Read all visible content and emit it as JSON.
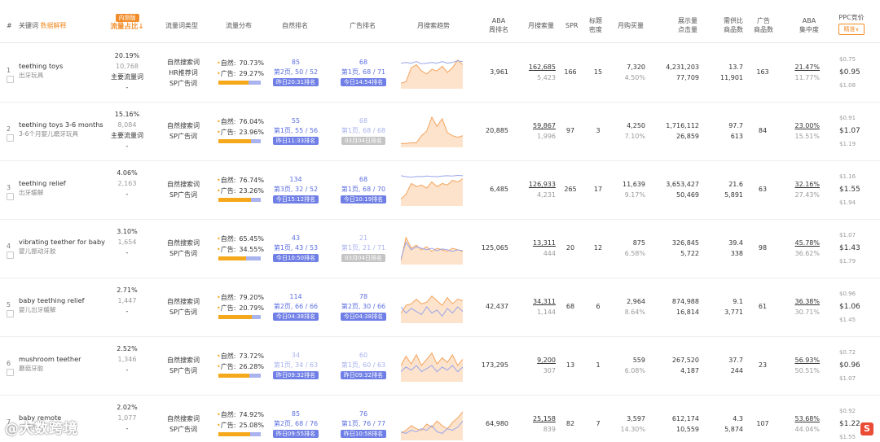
{
  "header": {
    "hash": "#",
    "keyword": "关键词",
    "keyword_link": "数据解释",
    "traffic_badge": "内测版",
    "traffic_share": "流量占比↓",
    "traffic_type": "流量词类型",
    "traffic_dist": "流量分布",
    "natural_rank": "自然排名",
    "ad_rank": "广告排名",
    "monthly_trend": "月搜索趋势",
    "aba_week_1": "ABA",
    "aba_week_2": "周排名",
    "monthly_search": "月搜索量",
    "spr": "SPR",
    "title_density_1": "标题",
    "title_density_2": "密度",
    "monthly_buy": "月购买量",
    "impressions_1": "展示量",
    "impressions_2": "点击量",
    "supply_1": "需供比",
    "supply_2": "商品数",
    "ad_products_1": "广告",
    "ad_products_2": "商品数",
    "aba_conc_1": "ABA",
    "aba_conc_2": "集中度",
    "ppc": "PPC竞价",
    "ppc_mode": "精准∨"
  },
  "rows": [
    {
      "idx": "1",
      "kw": "teething toys",
      "kwcn": "出牙玩具",
      "share": "20.19%",
      "share_count": "10,768",
      "main": "主要流量词",
      "dash": "-",
      "types": [
        "自然搜索词",
        "HR推荐词",
        "SP广告词"
      ],
      "nat_lbl": "自然:",
      "nat": "70.73%",
      "ad_lbl": "广告:",
      "ad": "29.27%",
      "nat_frac": 0.7073,
      "nrank": "85",
      "npage": "第2页, 50 / 52",
      "npill": "昨日20:31排名",
      "npill_gray": false,
      "nrank_gray": false,
      "arank": "68",
      "apage": "第1页, 68 / 71",
      "apill": "今日14:54排名",
      "apill_gray": false,
      "arank_gray": false,
      "aba": "3,961",
      "ms": "162,685",
      "ms2": "5,423",
      "spr": "166",
      "td": "15",
      "mb": "7,320",
      "mb2": "4.50%",
      "imp": "4,231,203",
      "clk": "77,709",
      "sup": "13.7",
      "prod": "11,901",
      "adp": "163",
      "conc": "21.47%",
      "conc2": "11.77%",
      "ppc_hi": "$0.75",
      "ppc": "$0.95",
      "ppc_lo": "$1.08",
      "trend": [
        0.15,
        0.2,
        0.65,
        0.75,
        0.55,
        0.45,
        0.6,
        0.55,
        0.7,
        0.5,
        0.65,
        0.9,
        0.75
      ],
      "trend2": [
        0.8,
        0.82,
        0.8,
        0.85,
        0.78,
        0.8,
        0.82,
        0.8,
        0.85,
        0.8,
        0.82,
        0.88,
        0.85
      ]
    },
    {
      "idx": "2",
      "kw": "teething toys 3-6 months",
      "kwcn": "3-6个月婴儿磨牙玩具",
      "share": "15.16%",
      "share_count": "8,084",
      "main": "主要流量词",
      "dash": "-",
      "types": [
        "自然搜索词",
        "SP广告词"
      ],
      "nat_lbl": "自然:",
      "nat": "76.04%",
      "ad_lbl": "广告:",
      "ad": "23.96%",
      "nat_frac": 0.7604,
      "nrank": "55",
      "npage": "第1页, 55 / 56",
      "npill": "昨日11:33排名",
      "npill_gray": false,
      "nrank_gray": false,
      "arank": "68",
      "apage": "第1页, 68 / 68",
      "apill": "03月04日排名",
      "apill_gray": true,
      "arank_gray": true,
      "aba": "20,885",
      "ms": "59,867",
      "ms2": "1,996",
      "spr": "97",
      "td": "3",
      "mb": "4,250",
      "mb2": "7.10%",
      "imp": "1,716,112",
      "clk": "26,859",
      "sup": "97.7",
      "prod": "613",
      "adp": "84",
      "conc": "23.00%",
      "conc2": "15.51%",
      "ppc_hi": "$0.91",
      "ppc": "$1.07",
      "ppc_lo": "$1.19",
      "trend": [
        0.1,
        0.1,
        0.12,
        0.12,
        0.35,
        0.5,
        0.95,
        0.65,
        0.9,
        0.45,
        0.35,
        0.3,
        0.35
      ],
      "trend2": null
    },
    {
      "idx": "3",
      "kw": "teething relief",
      "kwcn": "出牙缓解",
      "share": "4.06%",
      "share_count": "2,163",
      "main": "",
      "dash": "-",
      "types": [
        "自然搜索词",
        "SP广告词"
      ],
      "nat_lbl": "自然:",
      "nat": "76.74%",
      "ad_lbl": "广告:",
      "ad": "23.26%",
      "nat_frac": 0.7674,
      "nrank": "134",
      "npage": "第3页, 32 / 52",
      "npill": "今日15:12排名",
      "npill_gray": false,
      "nrank_gray": false,
      "arank": "68",
      "apage": "第1页, 68 / 70",
      "apill": "今日10:19排名",
      "apill_gray": false,
      "arank_gray": false,
      "aba": "6,485",
      "ms": "126,933",
      "ms2": "4,231",
      "spr": "265",
      "td": "17",
      "mb": "11,639",
      "mb2": "9.17%",
      "imp": "3,653,427",
      "clk": "50,469",
      "sup": "21.6",
      "prod": "5,891",
      "adp": "63",
      "conc": "32.16%",
      "conc2": "27.43%",
      "ppc_hi": "$1.16",
      "ppc": "$1.55",
      "ppc_lo": "$1.94",
      "trend": [
        0.2,
        0.35,
        0.7,
        0.6,
        0.65,
        0.55,
        0.75,
        0.6,
        0.7,
        0.65,
        0.8,
        0.75,
        0.85
      ],
      "trend2": [
        0.95,
        0.92,
        0.9,
        0.93,
        0.92,
        0.94,
        0.93,
        0.92,
        0.94,
        0.95,
        0.94,
        0.96,
        0.95
      ]
    },
    {
      "idx": "4",
      "kw": "vibrating teether for baby",
      "kwcn": "婴儿振动牙胶",
      "share": "3.10%",
      "share_count": "1,654",
      "main": "",
      "dash": "-",
      "types": [
        "自然搜索词",
        "SP广告词"
      ],
      "nat_lbl": "自然:",
      "nat": "65.45%",
      "ad_lbl": "广告:",
      "ad": "34.55%",
      "nat_frac": 0.6545,
      "nrank": "43",
      "npage": "第1页, 43 / 53",
      "npill": "今日10:50排名",
      "npill_gray": false,
      "nrank_gray": false,
      "arank": "21",
      "apage": "第1页, 21 / 71",
      "apill": "03月04日排名",
      "apill_gray": true,
      "arank_gray": true,
      "aba": "125,065",
      "ms": "13,311",
      "ms2": "444",
      "spr": "20",
      "td": "12",
      "mb": "875",
      "mb2": "6.58%",
      "imp": "326,845",
      "clk": "5,722",
      "sup": "39.4",
      "prod": "338",
      "adp": "98",
      "conc": "45.78%",
      "conc2": "36.62%",
      "ppc_hi": "$1.07",
      "ppc": "$1.43",
      "ppc_lo": "$1.79",
      "trend": [
        0.1,
        0.85,
        0.5,
        0.6,
        0.45,
        0.55,
        0.4,
        0.5,
        0.45,
        0.4,
        0.5,
        0.45,
        0.4
      ],
      "trend2": [
        0.15,
        0.7,
        0.45,
        0.55,
        0.5,
        0.45,
        0.5,
        0.42,
        0.48,
        0.45,
        0.4,
        0.45,
        0.42
      ]
    },
    {
      "idx": "5",
      "kw": "baby teething relief",
      "kwcn": "婴儿出牙缓解",
      "share": "2.71%",
      "share_count": "1,447",
      "main": "",
      "dash": "-",
      "types": [
        "自然搜索词",
        "SP广告词"
      ],
      "nat_lbl": "自然:",
      "nat": "79.20%",
      "ad_lbl": "广告:",
      "ad": "20.79%",
      "nat_frac": 0.792,
      "nrank": "114",
      "npage": "第2页, 66 / 66",
      "npill": "今日04:38排名",
      "npill_gray": false,
      "nrank_gray": false,
      "arank": "78",
      "apage": "第2页, 30 / 66",
      "apill": "今日04:38排名",
      "apill_gray": false,
      "arank_gray": false,
      "aba": "42,437",
      "ms": "34,311",
      "ms2": "1,144",
      "spr": "68",
      "td": "6",
      "mb": "2,964",
      "mb2": "8.64%",
      "imp": "874,988",
      "clk": "16,814",
      "sup": "9.1",
      "prod": "3,771",
      "adp": "61",
      "conc": "36.38%",
      "conc2": "30.71%",
      "ppc_hi": "$0.96",
      "ppc": "$1.06",
      "ppc_lo": "$1.45",
      "trend": [
        0.3,
        0.55,
        0.6,
        0.75,
        0.6,
        0.65,
        0.85,
        0.7,
        0.55,
        0.8,
        0.6,
        0.75,
        0.7
      ],
      "trend2": [
        0.5,
        0.3,
        0.45,
        0.35,
        0.25,
        0.5,
        0.3,
        0.4,
        0.2,
        0.45,
        0.3,
        0.5,
        0.35
      ]
    },
    {
      "idx": "6",
      "kw": "mushroom teether",
      "kwcn": "蘑菇牙胶",
      "share": "2.52%",
      "share_count": "1,346",
      "main": "",
      "dash": "-",
      "types": [
        "自然搜索词",
        "SP广告词"
      ],
      "nat_lbl": "自然:",
      "nat": "73.72%",
      "ad_lbl": "广告:",
      "ad": "26.28%",
      "nat_frac": 0.7372,
      "nrank": "34",
      "npage": "第1页, 34 / 63",
      "npill": "昨日09:32排名",
      "npill_gray": false,
      "nrank_gray": true,
      "arank": "60",
      "apage": "第1页, 60 / 63",
      "apill": "昨日09:32排名",
      "apill_gray": false,
      "arank_gray": true,
      "aba": "173,295",
      "ms": "9,200",
      "ms2": "307",
      "spr": "13",
      "td": "1",
      "mb": "559",
      "mb2": "6.08%",
      "imp": "267,520",
      "clk": "4,187",
      "sup": "37.7",
      "prod": "244",
      "adp": "23",
      "conc": "56.93%",
      "conc2": "50.51%",
      "ppc_hi": "$0.72",
      "ppc": "$0.96",
      "ppc_lo": "$1.07",
      "trend": [
        0.5,
        0.8,
        0.55,
        0.85,
        0.5,
        0.7,
        0.9,
        0.55,
        0.75,
        0.6,
        0.85,
        0.5,
        0.7
      ],
      "trend2": [
        0.3,
        0.45,
        0.35,
        0.5,
        0.3,
        0.4,
        0.5,
        0.3,
        0.45,
        0.35,
        0.5,
        0.3,
        0.45
      ]
    },
    {
      "idx": "7",
      "kw": "baby remote",
      "kwcn": "儿遥控",
      "share": "2.02%",
      "share_count": "1,077",
      "main": "",
      "dash": "-",
      "types": [
        "自然搜索词",
        "SP广告词"
      ],
      "nat_lbl": "自然:",
      "nat": "74.92%",
      "ad_lbl": "广告:",
      "ad": "25.08%",
      "nat_frac": 0.7492,
      "nrank": "85",
      "npage": "第2页, 68 / 76",
      "npill": "昨日09:55排名",
      "npill_gray": false,
      "nrank_gray": false,
      "arank": "76",
      "apage": "第1页, 76 / 77",
      "apill": "昨日10:58排名",
      "apill_gray": false,
      "arank_gray": false,
      "aba": "64,980",
      "ms": "25,158",
      "ms2": "839",
      "spr": "82",
      "td": "7",
      "mb": "3,597",
      "mb2": "14.30%",
      "imp": "612,174",
      "clk": "10,559",
      "sup": "4.3",
      "prod": "5,874",
      "adp": "107",
      "conc": "53.68%",
      "conc2": "44.04%",
      "ppc_hi": "$0.92",
      "ppc": "$1.22",
      "ppc_lo": "$1.55",
      "trend": [
        0.2,
        0.3,
        0.45,
        0.35,
        0.3,
        0.5,
        0.4,
        0.6,
        0.45,
        0.35,
        0.55,
        0.7,
        0.9
      ],
      "trend2": [
        0.25,
        0.2,
        0.3,
        0.25,
        0.35,
        0.3,
        0.45,
        0.25,
        0.2,
        0.35,
        0.3,
        0.4,
        0.6
      ]
    }
  ],
  "watermark": "@大数跨境",
  "corner_logo": "S"
}
